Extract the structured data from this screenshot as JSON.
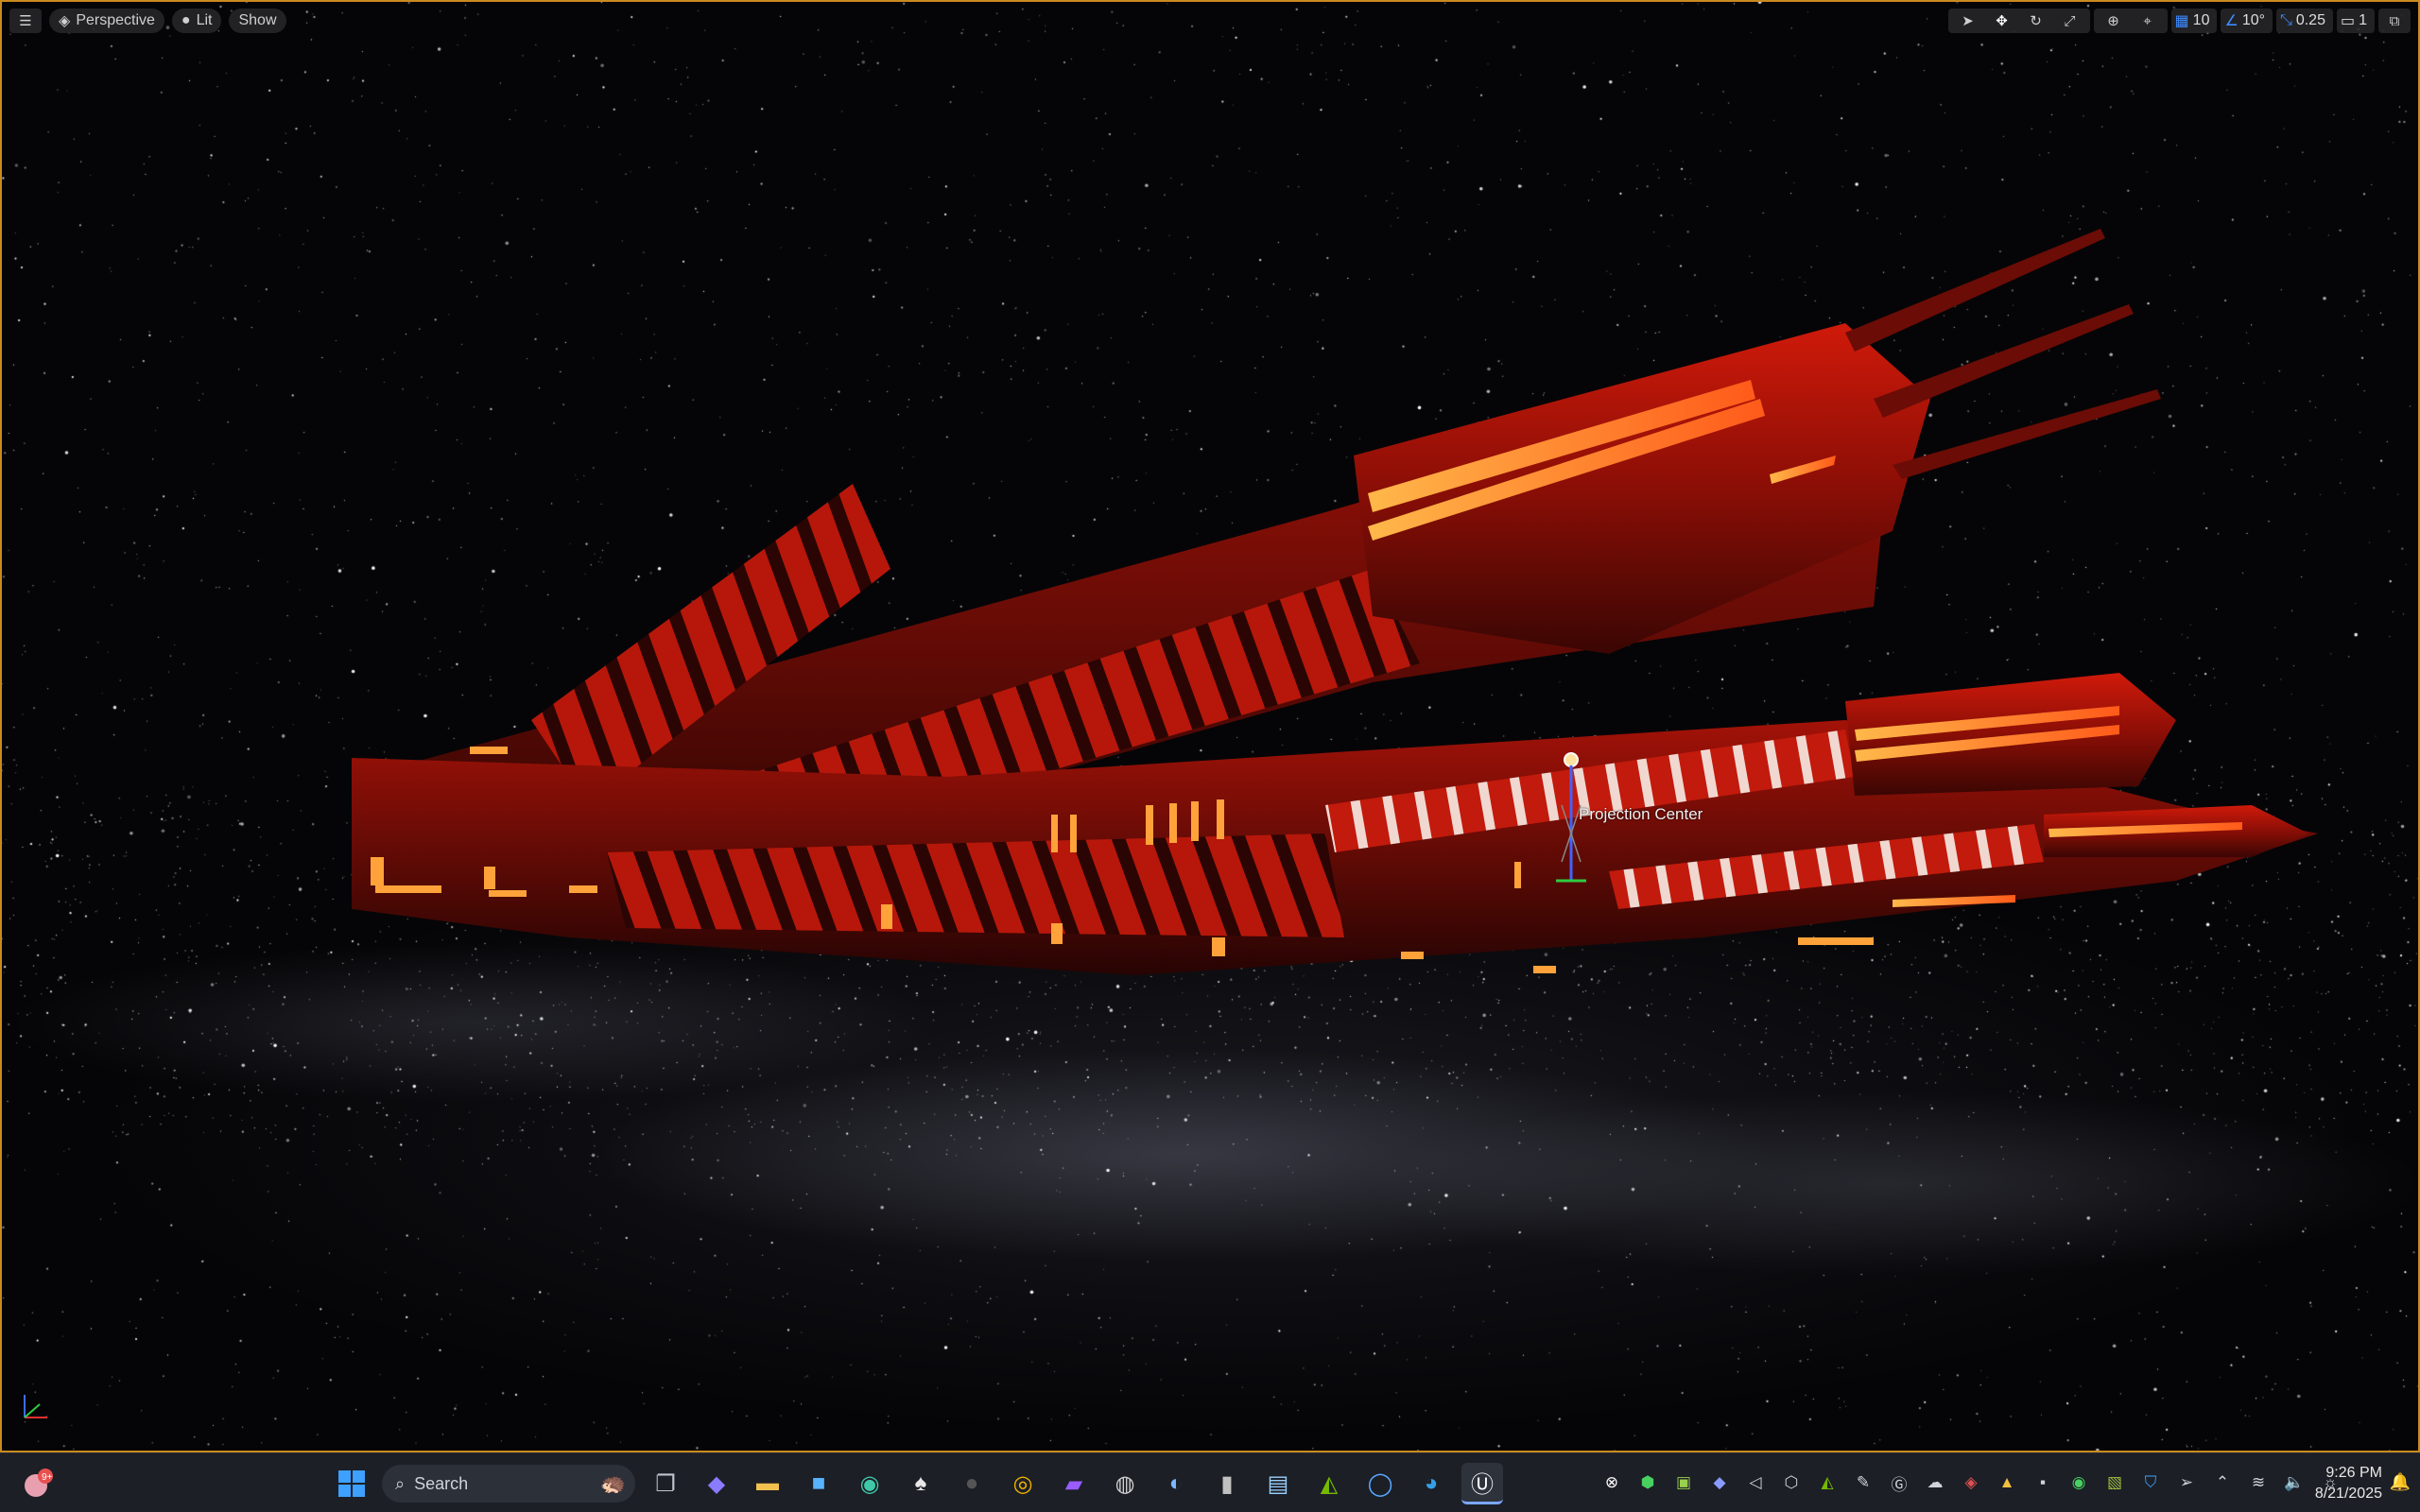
{
  "viewport": {
    "menu_icon": "hamburger-icon",
    "perspective_label": "Perspective",
    "lit_label": "Lit",
    "show_label": "Show",
    "grid_snap_value": "10",
    "rotate_snap_value": "10°",
    "scale_snap_value": "0.25",
    "camera_speed_value": "1",
    "projection_label": "Projection Center",
    "accent_color": "#1d5fd1",
    "border_color": "#c98a1e"
  },
  "taskbar": {
    "search_placeholder": "Search",
    "time": "9:26 PM",
    "date": "8/21/2025",
    "apps": [
      "windows-start",
      "task-view",
      "copilot",
      "file-explorer",
      "store",
      "edge-dev",
      "alienware",
      "steam",
      "chrome",
      "clipchamp",
      "obs",
      "photos",
      "phone-link",
      "ide",
      "nvidia",
      "earth",
      "edge",
      "unreal-engine"
    ]
  }
}
